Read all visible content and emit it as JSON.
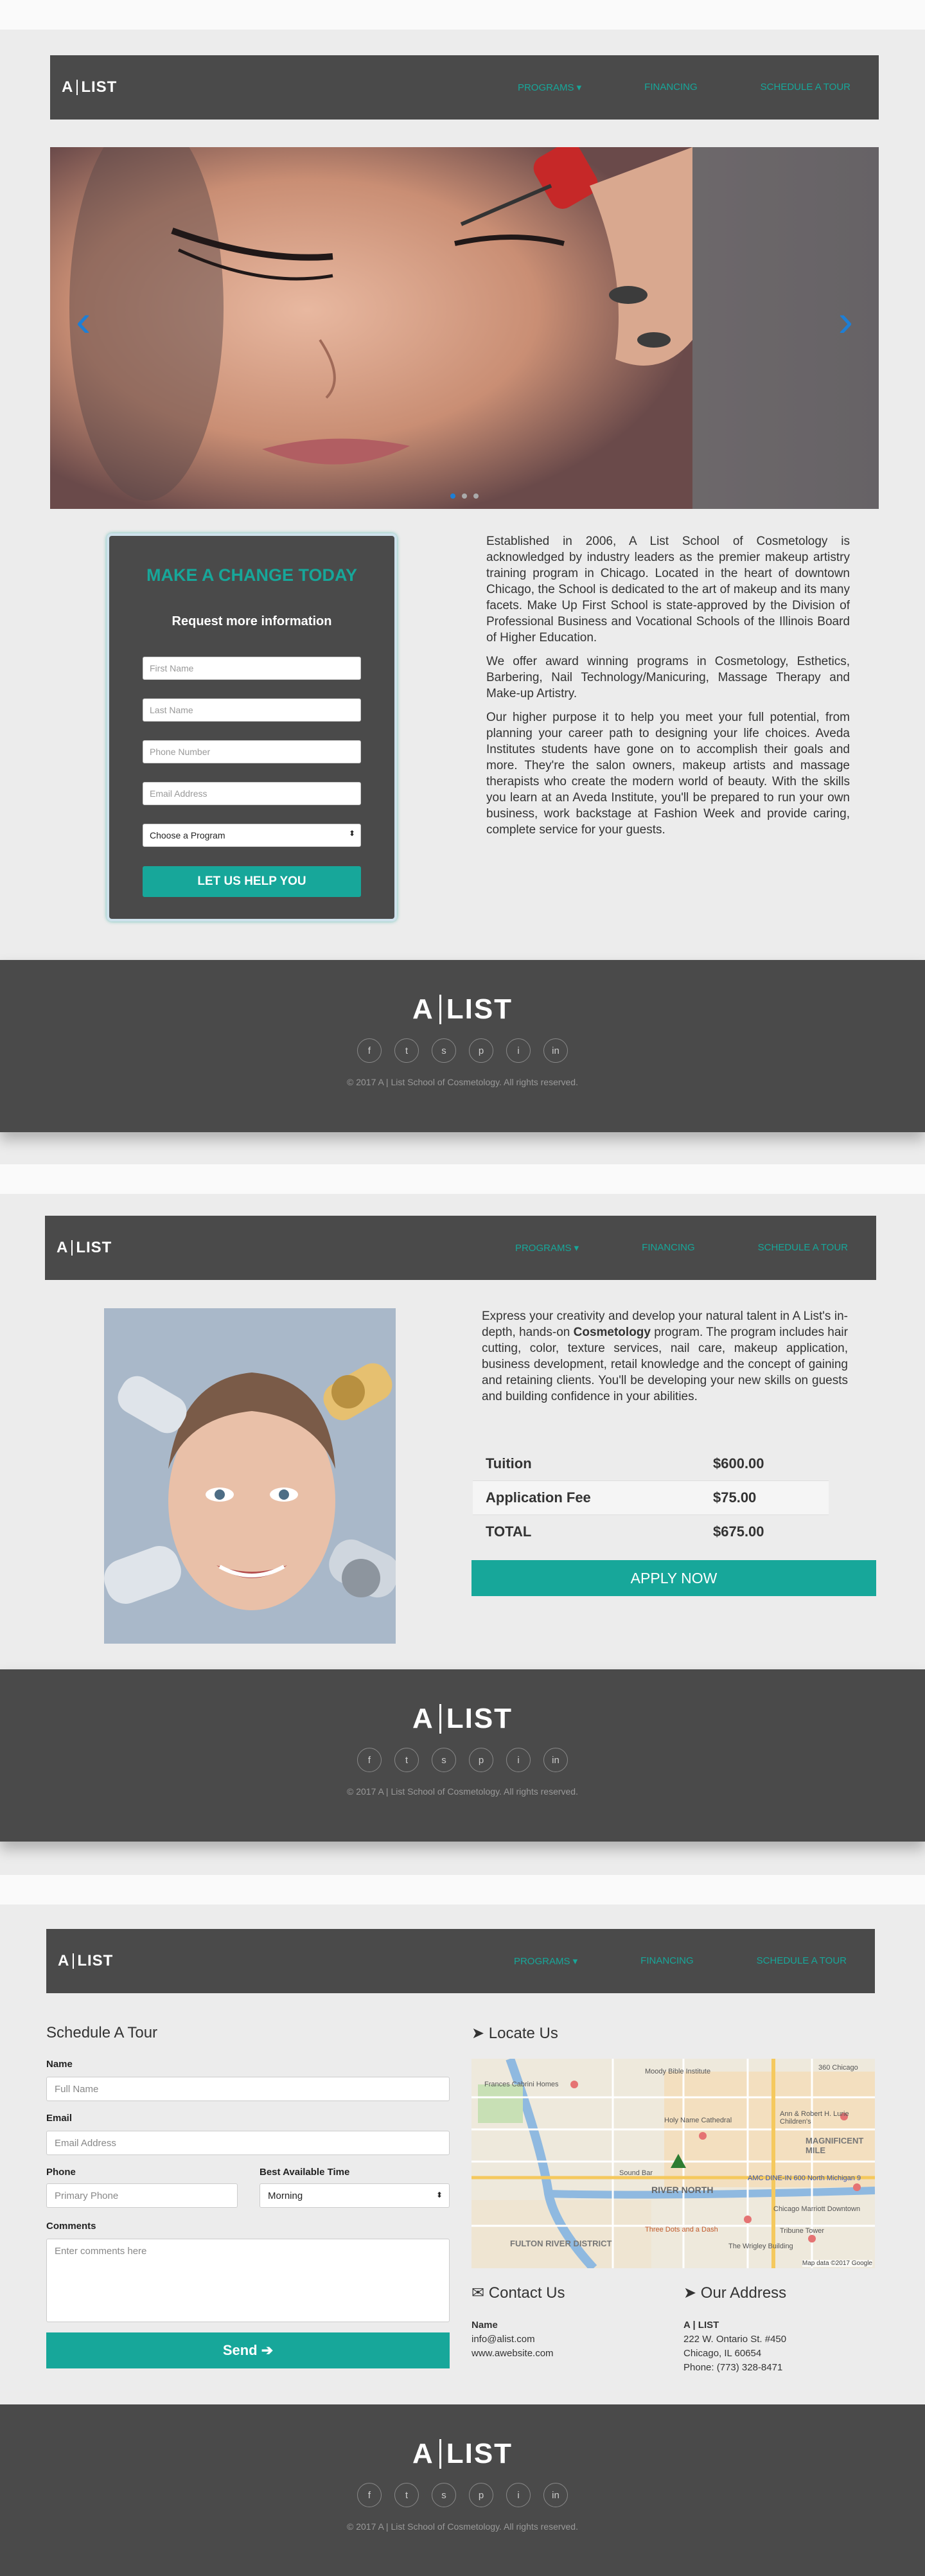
{
  "brand": {
    "logo_left": "A",
    "logo_right": "LIST",
    "accent": "#17a79a",
    "dark": "#4a4a4a"
  },
  "nav": {
    "programs": "PROGRAMS ▾",
    "financing": "FINANCING",
    "schedule": "SCHEDULE A TOUR"
  },
  "hero": {
    "alt": "mascara-application-photo",
    "slides": 3,
    "active_slide": 1
  },
  "lead_form": {
    "title": "MAKE A CHANGE TODAY",
    "subtitle": "Request more information",
    "first_name": "First Name",
    "last_name": "Last Name",
    "phone": "Phone Number",
    "email": "Email Address",
    "program": "Choose a Program",
    "submit": "LET US HELP YOU"
  },
  "about": {
    "p1": "Established in 2006, A List School of Cosmetology is acknowledged by industry leaders as the premier makeup artistry training program in Chicago. Located in the heart of downtown Chicago, the School is dedicated to the art of makeup and its many facets. Make Up First School is state-approved by the Division of Professional Business and Vocational Schools of the Illinois Board of Higher Education.",
    "p2": "We offer award winning programs in Cosmetology, Esthetics, Barbering, Nail Technology/Manicuring, Massage Therapy and Make-up Artistry.",
    "p3": "Our higher purpose it to help you meet your full potential, from planning your career path to designing your life choices. Aveda Institutes students have gone on to accomplish their goals and more. They're the salon owners, makeup artists and massage therapists who create the modern world of beauty. With the skills you learn at an Aveda Institute, you'll be prepared to run your own business, work backstage at Fashion Week and provide caring, complete service for your guests."
  },
  "footer": {
    "copyright": "© 2017 A | List School of Cosmetology. All rights reserved.",
    "socials": [
      "f",
      "t",
      "s",
      "p",
      "i",
      "in"
    ]
  },
  "program": {
    "text_before": "Express your creativity and develop your natural talent in A List's in-depth, hands-on ",
    "text_bold": "Cosmetology",
    "text_after": " program. The program includes hair cutting, color, texture services, nail care, makeup application, business development, retail knowledge and the concept of gaining and retaining clients. You'll be developing your new skills on guests and building confidence in your abilities.",
    "fees": [
      {
        "label": "Tuition",
        "amount": "$600.00"
      },
      {
        "label": "Application Fee",
        "amount": "$75.00"
      },
      {
        "label": "TOTAL",
        "amount": "$675.00"
      }
    ],
    "apply": "APPLY NOW"
  },
  "tour": {
    "title": "Schedule A Tour",
    "name_label": "Name",
    "name_ph": "Full Name",
    "email_label": "Email",
    "email_ph": "Email Address",
    "phone_label": "Phone",
    "phone_ph": "Primary Phone",
    "time_label": "Best Available Time",
    "time_value": "Morning",
    "comments_label": "Comments",
    "comments_ph": "Enter comments here",
    "send": "Send ➔"
  },
  "locate": {
    "title": "Locate Us",
    "map_labels": [
      "Moody Bible Institute",
      "360 Chicago",
      "Frances Cabrini Homes",
      "Holy Name Cathedral",
      "MAGNIFICENT MILE",
      "Ann & Robert H. Lurie Children's",
      "RIVER NORTH",
      "AMC DINE-IN 600 North Michigan 9",
      "Sound Bar",
      "Chicago Marriott Downtown",
      "Three Dots and a Dash",
      "Tribune Tower",
      "FULTON RIVER DISTRICT",
      "The Wrigley Building",
      "Map data ©2017 Google"
    ]
  },
  "contact": {
    "title": "Contact Us",
    "name_label": "Name",
    "email": "info@alist.com",
    "website": "www.awebsite.com"
  },
  "address": {
    "title": "Our Address",
    "name": "A | LIST",
    "line1": "222 W. Ontario St. #450",
    "line2": "Chicago, IL 60654",
    "phone": "Phone: (773) 328-8471"
  }
}
